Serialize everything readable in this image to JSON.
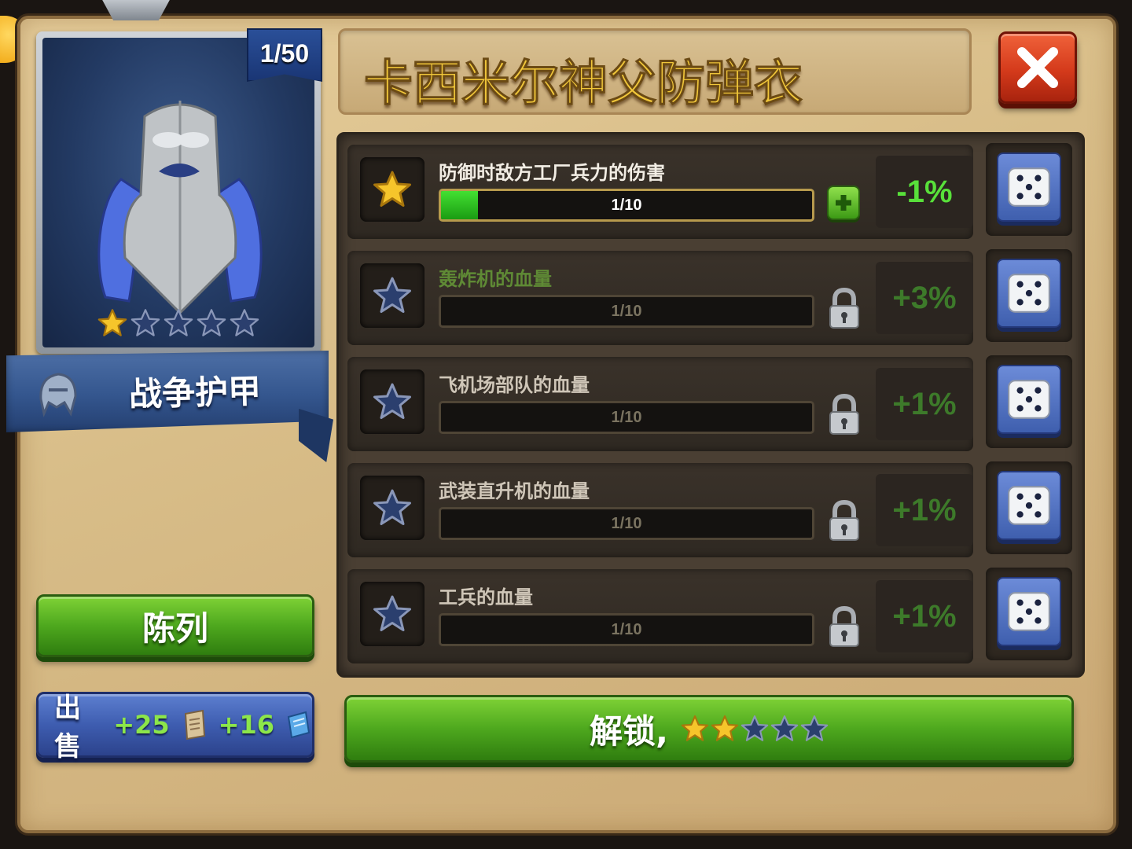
{
  "item": {
    "title": "卡西米尔神父防弹衣",
    "count": "1/50",
    "stars_filled": 1,
    "stars_total": 5,
    "category": "战争护甲"
  },
  "buttons": {
    "arrange": "陈列",
    "sell_label": "出售",
    "sell_reward_1": "+25",
    "sell_reward_2": "+16",
    "unlock_label": "解锁,",
    "unlock_stars_filled": 2,
    "unlock_stars_total": 5
  },
  "stats": [
    {
      "label": "防御时敌方工厂兵力的伤害",
      "progress": "1/10",
      "fill": 0.1,
      "value": "-1%",
      "state": "active"
    },
    {
      "label": "轰炸机的血量",
      "progress": "1/10",
      "fill": 0,
      "value": "+3%",
      "state": "locked"
    },
    {
      "label": "飞机场部队的血量",
      "progress": "1/10",
      "fill": 0,
      "value": "+1%",
      "state": "locked"
    },
    {
      "label": "武装直升机的血量",
      "progress": "1/10",
      "fill": 0,
      "value": "+1%",
      "state": "locked"
    },
    {
      "label": "工兵的血量",
      "progress": "1/10",
      "fill": 0,
      "value": "+1%",
      "state": "locked"
    }
  ],
  "icons": {
    "close": "close-icon",
    "dice": "dice-icon",
    "lock": "lock-icon",
    "star": "star-icon",
    "plus": "plus-icon",
    "helmet": "helmet-icon",
    "scroll": "scroll-icon",
    "blueprint": "blueprint-icon"
  },
  "colors": {
    "gold_star": "#f6c52b",
    "empty_star": "#2b3f6e",
    "green_value": "#58e03a",
    "panel_bg": "#d8bd88"
  }
}
